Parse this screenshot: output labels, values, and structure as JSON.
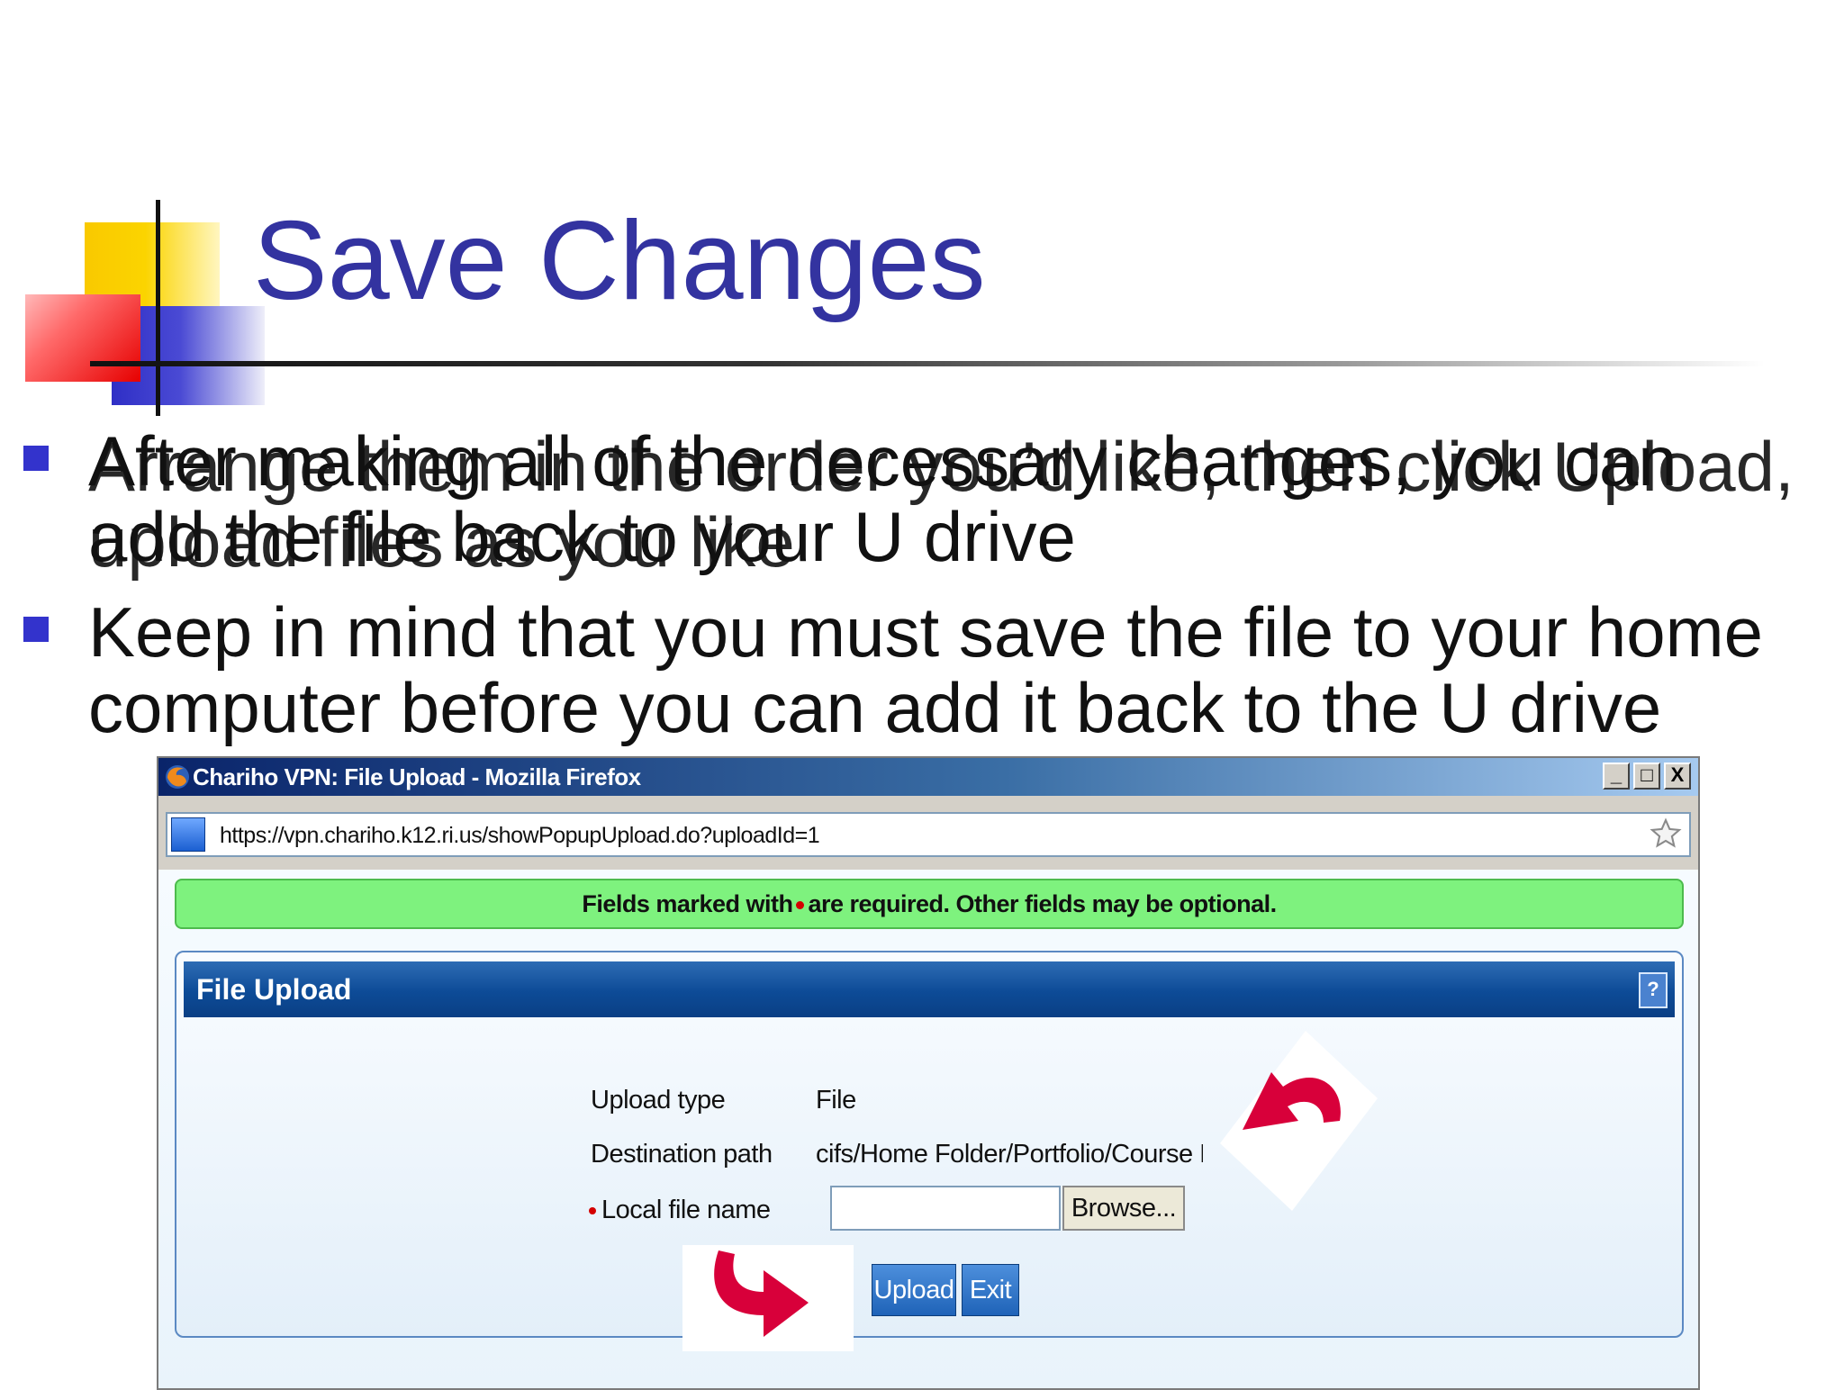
{
  "slide": {
    "title": "Save Changes",
    "bullet1_lines_a": [
      "After making all of the necessary changes, you can",
      "add the file back to your U drive"
    ],
    "bullet1_lines_b": [
      "Arrange them in the order you’d like, then click Upload,",
      "upload files as you like"
    ],
    "bullet2_lines": [
      "Keep in mind that you must save the file to your home",
      "computer before you can add it back to the U drive"
    ],
    "colors": {
      "title": "#3333a0",
      "bullet": "#3333cc"
    }
  },
  "browser": {
    "window_title": "Chariho VPN: File Upload - Mozilla Firefox",
    "url": "https://vpn.chariho.k12.ri.us/showPopupUpload.do?uploadId=1",
    "title_buttons": {
      "minimize": "_",
      "maximize": "□",
      "close": "X"
    },
    "notice": {
      "before": "Fields marked with",
      "after": "are required. Other fields may be optional."
    },
    "panel": {
      "title": "File Upload",
      "help": "?",
      "fields": [
        {
          "label": "Upload type",
          "value": "File"
        },
        {
          "label": "Destination path",
          "value": "cifs/Home Folder/Portfolio/Course Proje..."
        },
        {
          "label": "Local file name",
          "value": ""
        }
      ],
      "browse_label": "Browse...",
      "upload_label": "Upload",
      "exit_label": "Exit"
    },
    "icons": [
      "firefox-icon",
      "site-icon",
      "bookmark-star-icon",
      "red-arrow-icon"
    ],
    "colors": {
      "notice_bg": "#7ef27e",
      "panel_head": "#0d4b97",
      "button": "#1f63b8",
      "arrow": "#d8003a"
    }
  }
}
